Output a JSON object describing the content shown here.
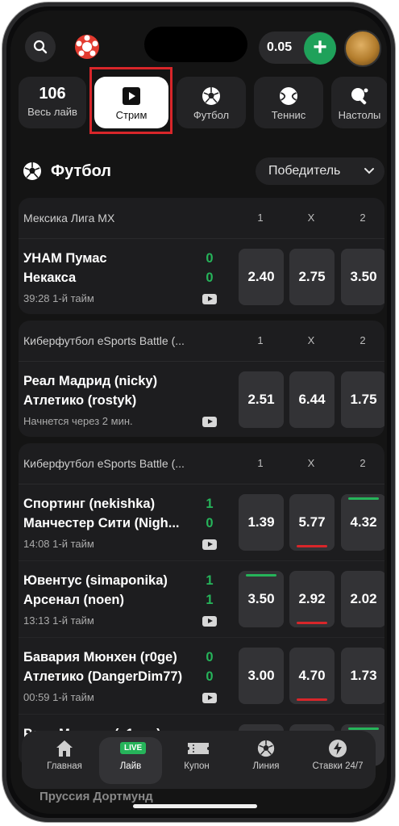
{
  "header": {
    "balance": "0.05",
    "plus_label": "+"
  },
  "categories": [
    {
      "count": "106",
      "label": "Весь лайв"
    },
    {
      "label": "Стрим"
    },
    {
      "label": "Футбол"
    },
    {
      "label": "Теннис"
    },
    {
      "label": "Настолы"
    }
  ],
  "section": {
    "title": "Футбол",
    "market": "Победитель"
  },
  "leagues": [
    {
      "name": "Мексика Лига MX",
      "cols": [
        "1",
        "X",
        "2"
      ],
      "matches": [
        {
          "team1": "УНАМ Пумас",
          "team2": "Некакса",
          "score1": "0",
          "score2": "0",
          "time": "39:28 1-й тайм",
          "odds": [
            "2.40",
            "2.75",
            "3.50"
          ]
        }
      ]
    },
    {
      "name": "Киберфутбол eSports Battle (...",
      "cols": [
        "1",
        "X",
        "2"
      ],
      "matches": [
        {
          "team1": "Реал Мадрид (nicky)",
          "team2": "Атлетико (rostyk)",
          "score1": "",
          "score2": "",
          "time": "Начнется через 2 мин.",
          "odds": [
            "2.51",
            "6.44",
            "1.75"
          ]
        }
      ]
    },
    {
      "name": "Киберфутбол eSports Battle (...",
      "cols": [
        "1",
        "X",
        "2"
      ],
      "matches": [
        {
          "team1": "Спортинг (nekishka)",
          "team2": "Манчестер Сити (Nigh...",
          "score1": "1",
          "score2": "0",
          "time": "14:08 1-й тайм",
          "odds": [
            "1.39",
            "5.77",
            "4.32"
          ]
        },
        {
          "team1": "Ювентус (simaponika)",
          "team2": "Арсенал (noen)",
          "score1": "1",
          "score2": "1",
          "time": "13:13 1-й тайм",
          "odds": [
            "3.50",
            "2.92",
            "2.02"
          ]
        },
        {
          "team1": "Бавария Мюнхен (r0ge)",
          "team2": "Атлетико (DangerDim77)",
          "score1": "0",
          "score2": "0",
          "time": "00:59 1-й тайм",
          "odds": [
            "3.00",
            "4.70",
            "1.73"
          ]
        },
        {
          "team1": "Реал Мадрид (s1ose)",
          "team2": "",
          "score1": "",
          "score2": "",
          "time": "",
          "odds": [
            "",
            "",
            ""
          ]
        }
      ]
    }
  ],
  "peek_text": "Пруссия Дортмунд",
  "tabbar": [
    {
      "label": "Главная"
    },
    {
      "label": "Лайв",
      "badge": "LIVE"
    },
    {
      "label": "Купон"
    },
    {
      "label": "Линия"
    },
    {
      "label": "Ставки 24/7"
    }
  ]
}
